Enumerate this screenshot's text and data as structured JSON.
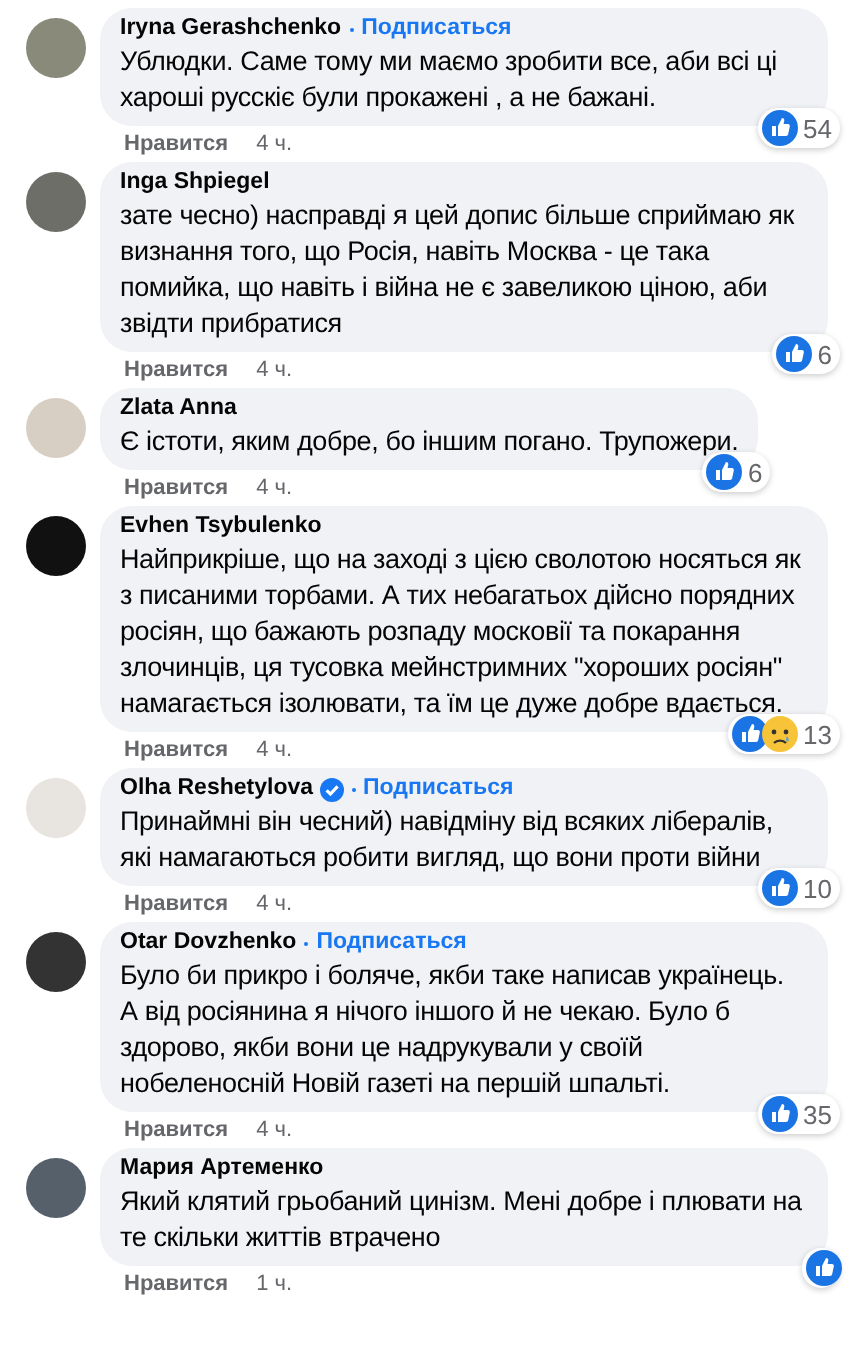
{
  "comments": [
    {
      "author": "Iryna Gerashchenko",
      "follow": "Подписаться",
      "text": "Ублюдки. Саме тому ми маємо зробити все, аби всі ці хароші русскіє були прокажені , а не бажані.",
      "reactions": [
        {
          "kind": "like"
        }
      ],
      "count": "54",
      "like": "Нравится",
      "time": "4 ч."
    },
    {
      "author": "Inga Shpiegel",
      "text": "зате чесно) насправді я цей допис більше сприймаю як визнання того, що Росія, навіть Москва - це така помийка, що навіть і війна не є завеликою ціною, аби звідти прибратися",
      "reactions": [
        {
          "kind": "like"
        }
      ],
      "count": "6",
      "like": "Нравится",
      "time": "4 ч."
    },
    {
      "author": "Zlata Anna",
      "text": "Є істоти, яким добре, бо іншим погано. Трупожери.",
      "reactions": [
        {
          "kind": "like"
        }
      ],
      "count": "6",
      "like": "Нравится",
      "time": "4 ч."
    },
    {
      "author": "Evhen Tsybulenko",
      "text": "Найприкріше, що на заході з цією сволотою носяться як з писаними торбами. А тих небагатьох дійсно порядних росіян, що бажають розпаду московії та покарання злочинців, ця тусовка мейнстримних \"хороших росіян\" намагається ізолювати, та їм це дуже добре вдається.",
      "reactions": [
        {
          "kind": "like"
        },
        {
          "kind": "sad"
        }
      ],
      "count": "13",
      "like": "Нравится",
      "time": "4 ч."
    },
    {
      "author": "Olha Reshetylova",
      "verified": true,
      "follow": "Подписаться",
      "text": "Принаймні він чесний) навідміну від всяких лібералів, які намагаються робити вигляд, що вони проти війни",
      "reactions": [
        {
          "kind": "like"
        }
      ],
      "count": "10",
      "like": "Нравится",
      "time": "4 ч."
    },
    {
      "author": "Otar Dovzhenko",
      "follow": "Подписаться",
      "text": "Було би прикро і боляче, якби таке написав українець. А від росіянина я нічого іншого й не чекаю. Було б здорово, якби вони це надрукували у своїй нобеленосній Новій газеті на першій шпальті.",
      "reactions": [
        {
          "kind": "like"
        }
      ],
      "count": "35",
      "like": "Нравится",
      "time": "4 ч."
    },
    {
      "author": "Мария Артеменко",
      "text": "Який клятий грьобаний цинізм. Мені добре і плювати на те скільки життів втрачено",
      "reactions": [
        {
          "kind": "like"
        }
      ],
      "like": "Нравится",
      "time": "1 ч."
    }
  ]
}
